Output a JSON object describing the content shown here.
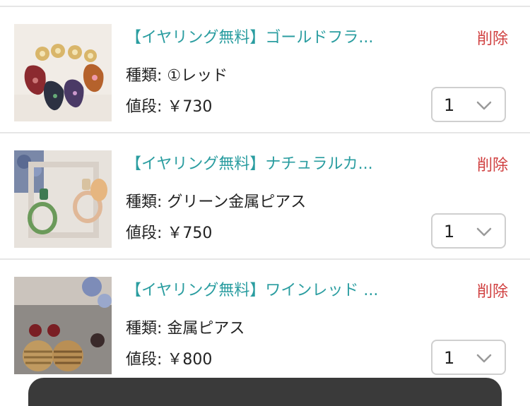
{
  "cart": {
    "items": [
      {
        "title": "【イヤリング無料】ゴールドフラ...",
        "variant_text": "種類: ①レッド",
        "price_text": "値段: ￥730",
        "delete_label": "削除",
        "quantity": "1"
      },
      {
        "title": "【イヤリング無料】ナチュラルカ...",
        "variant_text": "種類: グリーン金属ピアス",
        "price_text": "値段: ￥750",
        "delete_label": "削除",
        "quantity": "1"
      },
      {
        "title": "【イヤリング無料】ワインレッド ...",
        "variant_text": "種類: 金属ピアス",
        "price_text": "値段: ￥800",
        "delete_label": "削除",
        "quantity": "1"
      }
    ]
  },
  "colors": {
    "title": "#2a9da0",
    "delete": "#d04040",
    "separator": "#e6e6e6"
  },
  "icons": {
    "dropdown": "chevron-down-icon"
  }
}
